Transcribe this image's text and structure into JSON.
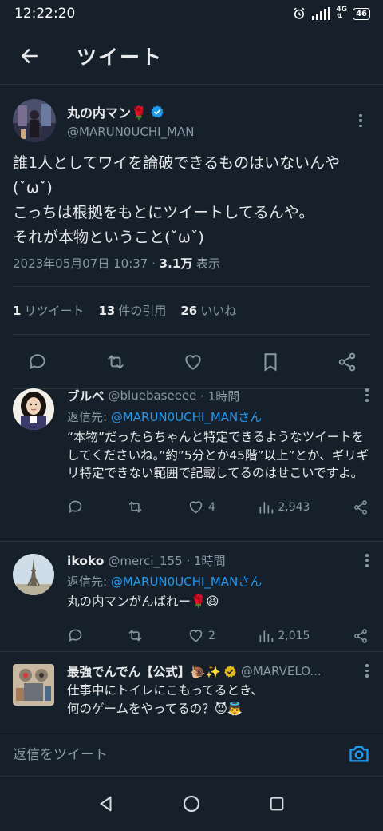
{
  "status_bar": {
    "time": "12:22:20",
    "network": "4G",
    "battery": "46"
  },
  "header": {
    "title": "ツイート"
  },
  "main_tweet": {
    "name": "丸の内マン🌹",
    "handle": "@MARUN0UCHI_MAN",
    "text": "誰1人としてワイを論破できるものはいないんや(ˇωˇ)\nこっちは根拠をもとにツイートしてるんや。\nそれが本物ということ(ˇωˇ)",
    "timestamp": "2023年05月07日 10:37 · ",
    "views_count": "3.1万",
    "views_label": " 表示",
    "retweets_count": "1",
    "retweets_label": "リツイート",
    "quotes_count": "13",
    "quotes_label": "件の引用",
    "likes_count": "26",
    "likes_label": "いいね"
  },
  "replies": [
    {
      "name": "ブルベ",
      "handle": "@bluebaseeee",
      "time": "· 1時間",
      "reply_to_label": "返信先: ",
      "reply_to_mention": "@MARUN0UCHI_MANさん",
      "text": "“本物”だったらちゃんと特定できるようなツイートをしてくださいね。”約”5分とか45階”以上”とか、ギリギリ特定できない範囲で記載してるのはせこいですよ。",
      "likes": "4",
      "views": "2,943"
    },
    {
      "name": "ikoko",
      "handle": "@merci_155",
      "time": "· 1時間",
      "reply_to_label": "返信先: ",
      "reply_to_mention": "@MARUN0UCHI_MANさん",
      "text": "丸の内マンがんばれー🌹😆",
      "likes": "2",
      "views": "2,015"
    },
    {
      "name": "最強でんでん【公式】🐌✨",
      "handle": "@MARVELO...",
      "text": "仕事中にトイレにこもってるとき、\n何のゲームをやってるの？😈👼"
    }
  ],
  "reply_box": {
    "placeholder": "返信をツイート"
  },
  "colors": {
    "background": "#15202b",
    "accent": "#1d9bf0",
    "secondary_text": "#8b98a5",
    "verified": "#1d9bf0",
    "gold_badge": "#e2b719"
  }
}
